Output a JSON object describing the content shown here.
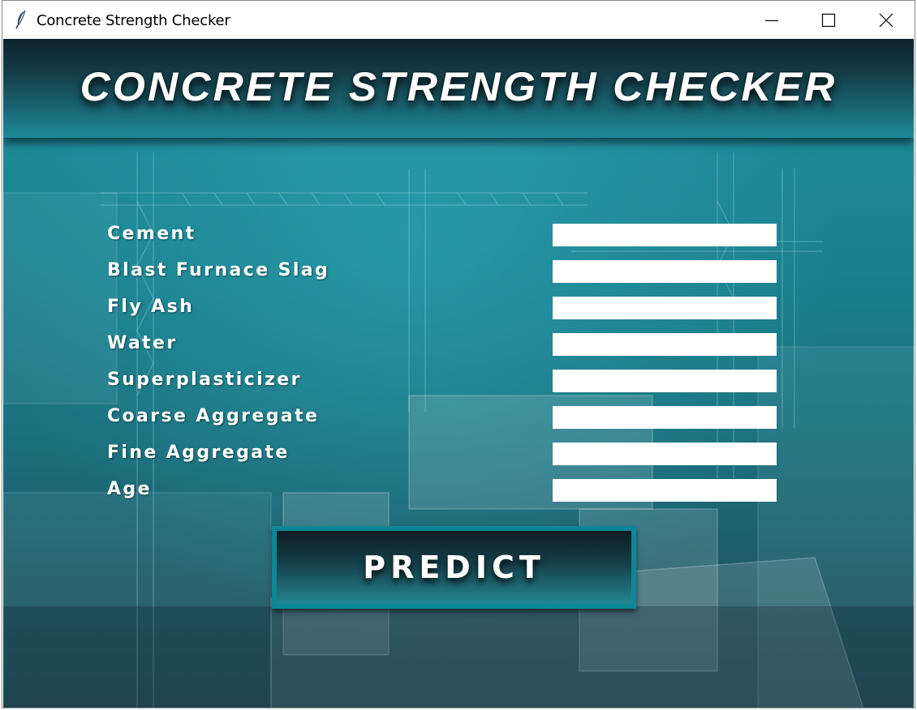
{
  "window": {
    "title": "Concrete Strength Checker",
    "controls": [
      "minimize-icon",
      "maximize-icon",
      "close-icon"
    ]
  },
  "header": {
    "title": "CONCRETE STRENGTH CHECKER"
  },
  "form": {
    "fields": [
      {
        "label": "Cement",
        "value": ""
      },
      {
        "label": "Blast Furnace Slag",
        "value": ""
      },
      {
        "label": "Fly Ash",
        "value": ""
      },
      {
        "label": "Water",
        "value": ""
      },
      {
        "label": "Superplasticizer",
        "value": ""
      },
      {
        "label": "Coarse Aggregate",
        "value": ""
      },
      {
        "label": "Fine Aggregate",
        "value": ""
      },
      {
        "label": "Age",
        "value": ""
      }
    ],
    "predict_label": "PREDICT"
  },
  "colors": {
    "accent": "#0c8796",
    "header_dark": "#0d222b",
    "background": "#1b7f8d"
  }
}
